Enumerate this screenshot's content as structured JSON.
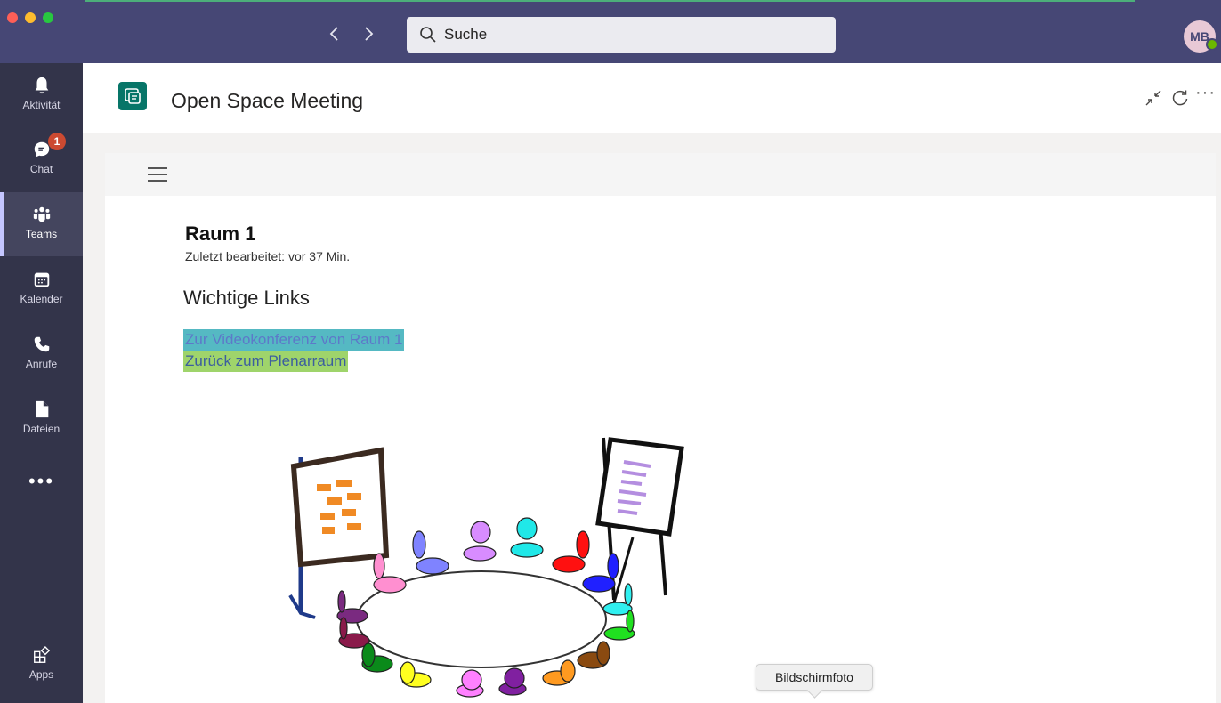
{
  "titlebar": {
    "search_placeholder": "Suche",
    "avatar_initials": "MB"
  },
  "rail": {
    "items": [
      {
        "label": "Aktivität",
        "icon": "bell-icon"
      },
      {
        "label": "Chat",
        "icon": "chat-icon",
        "badge": "1"
      },
      {
        "label": "Teams",
        "icon": "teams-icon",
        "active": true
      },
      {
        "label": "Kalender",
        "icon": "calendar-icon"
      },
      {
        "label": "Anrufe",
        "icon": "phone-icon"
      },
      {
        "label": "Dateien",
        "icon": "file-icon"
      }
    ],
    "more": "•••",
    "apps_label": "Apps"
  },
  "app_header": {
    "title": "Open Space Meeting"
  },
  "page": {
    "title": "Raum 1",
    "meta": "Zuletzt bearbeitet: vor 37 Min.",
    "section_title": "Wichtige Links",
    "links": [
      {
        "label": "Zur Videokonferenz von Raum 1"
      },
      {
        "label": "Zurück zum Plenarraum"
      }
    ]
  },
  "tooltip": {
    "text": "Bildschirmfoto"
  },
  "colors": {
    "titlebar": "#464775",
    "rail": "#33344a",
    "app_logo": "#077568",
    "link_1_highlight": "#55b9c3",
    "link_2_highlight": "#9fd46b",
    "badge": "#cc4a31"
  }
}
